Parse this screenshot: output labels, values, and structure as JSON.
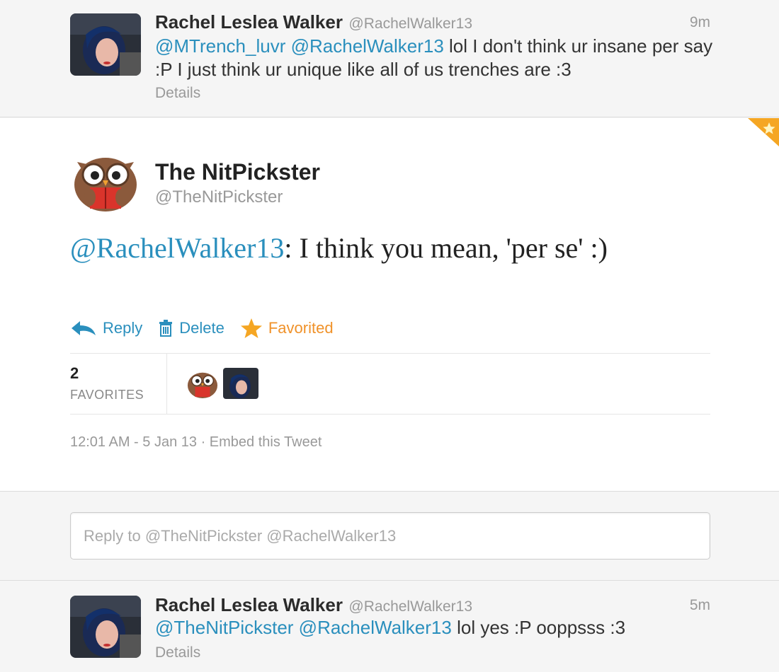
{
  "tweets_top": {
    "name": "Rachel Leslea Walker",
    "handle": "@RachelWalker13",
    "time": "9m",
    "mention1": "@MTrench_luvr",
    "mention2": "@RachelWalker13",
    "text": " lol I don't think ur insane per say :P I just think ur unique like all of us trenches are :3",
    "details": "Details"
  },
  "main": {
    "name": "The NitPickster",
    "handle": "@TheNitPickster",
    "mention": "@RachelWalker13",
    "text": ": I think you mean, 'per se' :)",
    "actions": {
      "reply": "Reply",
      "delete": "Delete",
      "favorited": "Favorited"
    },
    "favorites_count": "2",
    "favorites_label": "FAVORITES",
    "timestamp": "12:01 AM - 5 Jan 13",
    "separator": " · ",
    "embed": "Embed this Tweet"
  },
  "reply_box": {
    "placeholder": "Reply to @TheNitPickster @RachelWalker13"
  },
  "tweets_bottom": {
    "name": "Rachel Leslea Walker",
    "handle": "@RachelWalker13",
    "time": "5m",
    "mention1": "@TheNitPickster",
    "mention2": "@RachelWalker13",
    "text": " lol yes :P ooppsss :3",
    "details": "Details"
  },
  "colors": {
    "link": "#2a8fbd",
    "favorite": "#f0922a"
  }
}
